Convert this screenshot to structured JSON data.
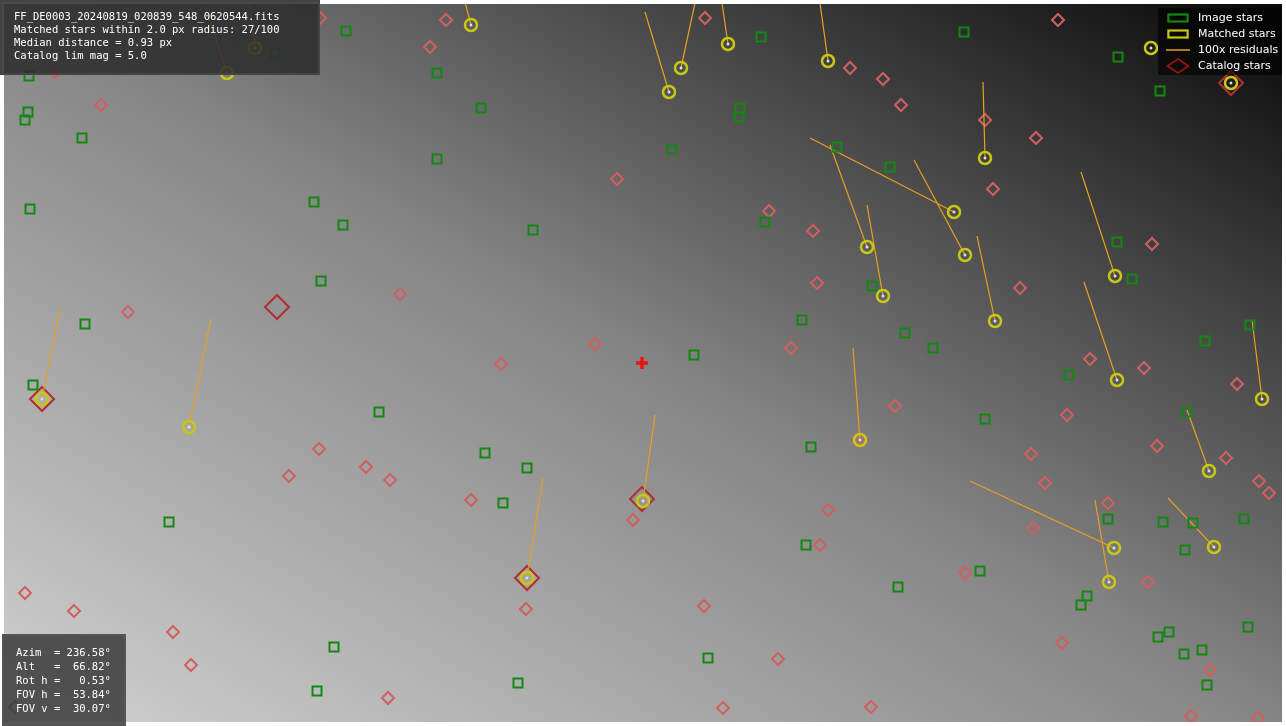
{
  "info_box": {
    "lines": [
      "FF_DE0003_20240819_020839_548_0620544.fits",
      "Matched stars within 2.0 px radius: 27/100",
      "Median distance = 0.93 px",
      "Catalog lim mag = 5.0"
    ]
  },
  "legend": {
    "items": [
      {
        "kind": "image",
        "label": "Image stars"
      },
      {
        "kind": "matched",
        "label": "Matched stars"
      },
      {
        "kind": "residual",
        "label": "100x residuals"
      },
      {
        "kind": "catalog",
        "label": "Catalog stars"
      }
    ]
  },
  "pointing_box": {
    "lines": [
      "Azim  = 236.58°",
      "Alt   =  66.82°",
      "Rot h =   0.53°",
      "FOV h =  53.84°",
      "FOV v =  30.07°"
    ]
  }
}
